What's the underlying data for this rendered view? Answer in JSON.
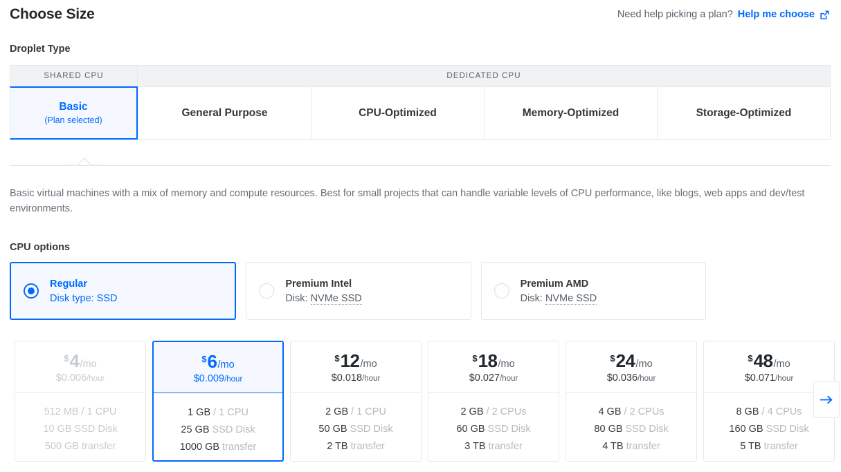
{
  "header": {
    "title": "Choose Size",
    "help_text": "Need help picking a plan?",
    "help_link": "Help me choose",
    "external_icon": "external-link-icon"
  },
  "droplet_type": {
    "label": "Droplet Type",
    "groups": [
      {
        "name": "SHARED CPU",
        "tabs": [
          {
            "title": "Basic",
            "sub": "(Plan selected)",
            "selected": true
          }
        ]
      },
      {
        "name": "DEDICATED CPU",
        "tabs": [
          {
            "title": "General Purpose",
            "sub": "",
            "selected": false
          },
          {
            "title": "CPU-Optimized",
            "sub": "",
            "selected": false
          },
          {
            "title": "Memory-Optimized",
            "sub": "",
            "selected": false
          },
          {
            "title": "Storage-Optimized",
            "sub": "",
            "selected": false
          }
        ]
      }
    ],
    "description": "Basic virtual machines with a mix of memory and compute resources. Best for small projects that can handle variable levels of CPU performance, like blogs, web apps and dev/test environments."
  },
  "cpu_options": {
    "label": "CPU options",
    "items": [
      {
        "name": "Regular",
        "disk_prefix": "Disk type: ",
        "disk_value": "SSD",
        "selected": true,
        "dotted": false
      },
      {
        "name": "Premium Intel",
        "disk_prefix": "Disk: ",
        "disk_value": "NVMe SSD",
        "selected": false,
        "dotted": true
      },
      {
        "name": "Premium AMD",
        "disk_prefix": "Disk: ",
        "disk_value": "NVMe SSD",
        "selected": false,
        "dotted": true
      }
    ]
  },
  "plans": [
    {
      "currency": "$",
      "monthly": "4",
      "per": "/mo",
      "hourly_amount": "$0.006",
      "hourly_unit": "/hour",
      "memory": "512 MB",
      "cpu": " / 1 CPU",
      "disk": "10 GB",
      "disk_label": " SSD Disk",
      "transfer": "500 GB",
      "transfer_label": " transfer",
      "selected": false,
      "disabled": true
    },
    {
      "currency": "$",
      "monthly": "6",
      "per": "/mo",
      "hourly_amount": "$0.009",
      "hourly_unit": "/hour",
      "memory": "1 GB",
      "cpu": " / 1 CPU",
      "disk": "25 GB",
      "disk_label": " SSD Disk",
      "transfer": "1000 GB",
      "transfer_label": " transfer",
      "selected": true,
      "disabled": false
    },
    {
      "currency": "$",
      "monthly": "12",
      "per": "/mo",
      "hourly_amount": "$0.018",
      "hourly_unit": "/hour",
      "memory": "2 GB",
      "cpu": " / 1 CPU",
      "disk": "50 GB",
      "disk_label": " SSD Disk",
      "transfer": "2 TB",
      "transfer_label": " transfer",
      "selected": false,
      "disabled": false
    },
    {
      "currency": "$",
      "monthly": "18",
      "per": "/mo",
      "hourly_amount": "$0.027",
      "hourly_unit": "/hour",
      "memory": "2 GB",
      "cpu": " / 2 CPUs",
      "disk": "60 GB",
      "disk_label": " SSD Disk",
      "transfer": "3 TB",
      "transfer_label": " transfer",
      "selected": false,
      "disabled": false
    },
    {
      "currency": "$",
      "monthly": "24",
      "per": "/mo",
      "hourly_amount": "$0.036",
      "hourly_unit": "/hour",
      "memory": "4 GB",
      "cpu": " / 2 CPUs",
      "disk": "80 GB",
      "disk_label": " SSD Disk",
      "transfer": "4 TB",
      "transfer_label": " transfer",
      "selected": false,
      "disabled": false
    },
    {
      "currency": "$",
      "monthly": "48",
      "per": "/mo",
      "hourly_amount": "$0.071",
      "hourly_unit": "/hour",
      "memory": "8 GB",
      "cpu": " / 4 CPUs",
      "disk": "160 GB",
      "disk_label": " SSD Disk",
      "transfer": "5 TB",
      "transfer_label": " transfer",
      "selected": false,
      "disabled": false
    }
  ],
  "next_button": {
    "icon": "arrow-right-icon"
  },
  "colors": {
    "accent": "#0069ff",
    "selected_bg": "#f5f9ff",
    "border": "#e5e8ea",
    "muted": "#b4bac0"
  }
}
